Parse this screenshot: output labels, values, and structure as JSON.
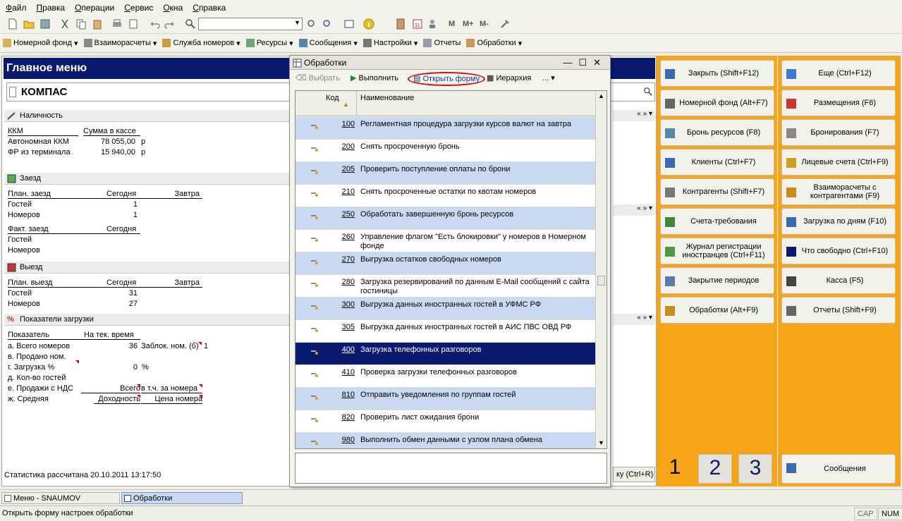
{
  "menubar": [
    "Файл",
    "Правка",
    "Операции",
    "Сервис",
    "Окна",
    "Справка"
  ],
  "toolbar2": [
    "Номерной фонд",
    "Взаиморасчеты",
    "Служба номеров",
    "Ресурсы",
    "Сообщения",
    "Настройки",
    "Отчеты",
    "Обработки"
  ],
  "toolbar1": {
    "m": "M",
    "mplus": "M+",
    "mminus": "M-"
  },
  "left": {
    "title": "Главное меню",
    "search_value": "КОМПАС",
    "nal": {
      "header": "Наличность",
      "col1": "ККМ",
      "col2": "Сумма в кассе",
      "r1_label": "Автономная ККМ",
      "r1_val": "78 055,00",
      "r1_cur": "р",
      "r2_label": "ФР из терминала",
      "r2_val": "15 940,00",
      "r2_cur": "р"
    },
    "zaezd": {
      "header": "Заезд",
      "plan": "План. заезд",
      "today": "Сегодня",
      "tomorrow": "Завтра",
      "guests": "Гостей",
      "rooms": "Номеров",
      "g_today": "1",
      "r_today": "1",
      "fact": "Факт. заезд",
      "f_today": "Сегодня",
      "f_guests": "Гостей",
      "f_rooms": "Номеров"
    },
    "vyezd": {
      "header": "Выезд",
      "plan": "План. выезд",
      "today": "Сегодня",
      "tomorrow": "Завтра",
      "guests": "Гостей",
      "rooms": "Номеров",
      "g_today": "31",
      "r_today": "27"
    },
    "load": {
      "header": "Показатели загрузки",
      "col1": "Показатель",
      "col2": "На тек. время",
      "a": "а. Всего номеров",
      "a_val": "36",
      "a_extra": "Заблок. ном. (б)",
      "a_extra_val": "1",
      "b": "в. Продано ном.",
      "g": "г. Загрузка %",
      "g_val": "0",
      "g_unit": "%",
      "d": "д. Кол-во гостей",
      "e": "е. Продажи с НДС",
      "e_v1": "Всего",
      "e_v2": "в т.ч. за номера",
      "zh": "ж. Средняя",
      "zh_v1": "Доходность",
      "zh_v2": "Цена номера"
    },
    "stat": "Статистика рассчитана 20.10.2011 13:17:50",
    "right_btn": "ку (Ctrl+R)"
  },
  "dialog": {
    "title": "Обработки",
    "btn_choose": "Выбрать",
    "btn_run": "Выполнить",
    "btn_open": "Открыть форму",
    "btn_hier": "Иерархия",
    "btn_more": "...",
    "col_code": "Код",
    "col_name": "Наименование",
    "rows": [
      {
        "code": "100",
        "name": "Регламентная процедура загрузки курсов валют на завтра"
      },
      {
        "code": "200",
        "name": "Снять просроченную бронь"
      },
      {
        "code": "205",
        "name": "Проверить поступление оплаты по брони"
      },
      {
        "code": "210",
        "name": "Снять просроченные остатки по квотам номеров"
      },
      {
        "code": "250",
        "name": "Обработать завершенную бронь ресурсов"
      },
      {
        "code": "260",
        "name": "Управление флагом \"Есть блокировки\" у номеров в Номерном фонде"
      },
      {
        "code": "270",
        "name": "Выгрузка остатков свободных номеров"
      },
      {
        "code": "280",
        "name": "Загрузка резервирований по данным E-Mail сообщений с сайта гостиницы"
      },
      {
        "code": "300",
        "name": "Выгрузка данных иностранных гостей в УФМС РФ"
      },
      {
        "code": "305",
        "name": "Выгрузка данных иностранных гостей в АИС ПВС ОВД РФ"
      },
      {
        "code": "400",
        "name": "Загрузка телефонных разговоров"
      },
      {
        "code": "410",
        "name": "Проверка загрузки телефонных разговоров"
      },
      {
        "code": "810",
        "name": "Отправить уведомления по группам гостей"
      },
      {
        "code": "820",
        "name": "Проверить лист ожидания брони"
      },
      {
        "code": "980",
        "name": "Выполнить обмен данными с узлом плана обмена"
      }
    ]
  },
  "mid_buttons": [
    "Закрыть (Shift+F12)",
    "Номерной фонд (Alt+F7)",
    "Бронь ресурсов (F8)",
    "Клиенты (Ctrl+F7)",
    "Контрагенты (Shift+F7)",
    "Счета-требования",
    "Журнал регистрации иностранцев (Ctrl+F11)",
    "Закрытие периодов",
    "Обработки (Alt+F9)"
  ],
  "right_buttons": [
    "Еще (Ctrl+F12)",
    "Размещения (F6)",
    "Бронирования (F7)",
    "Лицевые счета (Ctrl+F9)",
    "Взаиморасчеты с контрагентами (F9)",
    "Загрузка по дням (F10)",
    "Что свободно (Ctrl+F10)",
    "Касса (F5)",
    "Отчеты (Shift+F9)"
  ],
  "pages": [
    "1",
    "2",
    "3"
  ],
  "messages_btn": "Сообщения",
  "tasks": [
    "Меню - SNAUMOV",
    "Обработки"
  ],
  "status": {
    "text": "Открыть форму настроек обработки",
    "cap": "CAP",
    "num": "NUM"
  }
}
